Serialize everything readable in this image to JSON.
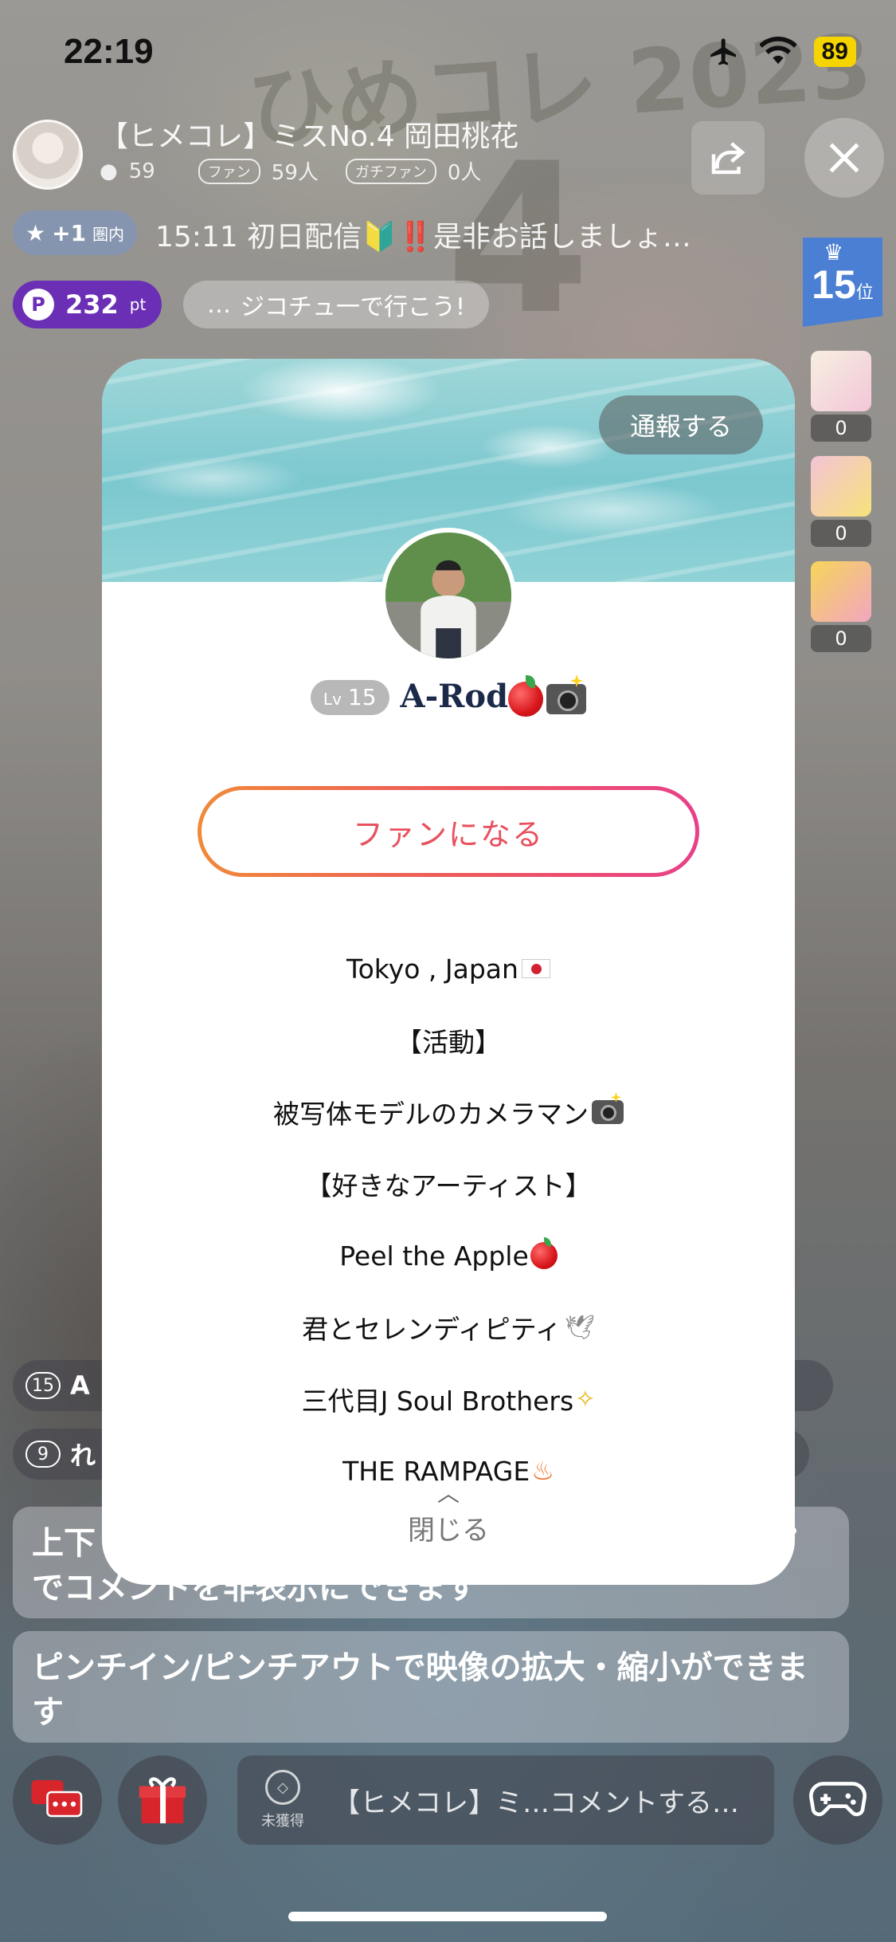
{
  "status_bar": {
    "time": "22:19",
    "battery": "89"
  },
  "stream": {
    "title": "【ヒメコレ】ミスNo.4 岡田桃花",
    "comment_count": "59",
    "fan_label": "ファン",
    "fan_count": "59人",
    "gachi_label": "ガチファン",
    "gachi_count": "0人",
    "rank": {
      "number": "15",
      "unit": "位"
    },
    "fan_tag": {
      "text": "+1",
      "sub": "圏内"
    },
    "ticker": "15:11  初日配信🔰‼️是非お話しましょ…",
    "points": {
      "value": "232",
      "unit": "pt"
    },
    "catchphrase": "ジコチュ一で行こう!",
    "gifts": [
      {
        "count": "0"
      },
      {
        "count": "0"
      },
      {
        "count": "0"
      }
    ]
  },
  "chat": {
    "rows": [
      {
        "level": "15",
        "text": "A"
      },
      {
        "level": "9",
        "text": "れ"
      }
    ],
    "system_messages": [
      "上下　　　　　　　　　　　　　　　　　　　　　プ\nでコメントを非表示にできます",
      "ピンチイン/ピンチアウトで映像の拡大・縮小ができます"
    ]
  },
  "bottom_bar": {
    "unearned_label": "未獲得",
    "comment_placeholder": "【ヒメコレ】ミ…コメントする…"
  },
  "profile": {
    "report_label": "通報する",
    "level_prefix": "Lv",
    "level": "15",
    "name": "A-Rod",
    "fan_button_label": "ファンになる",
    "bio": [
      "Tokyo , Japan",
      "【活動】",
      "被写体モデルのカメラマン",
      "【好きなアーティスト】",
      "Peel the Apple",
      "君とセレンディピティ",
      "三代目J Soul Brothers",
      "THE RAMPAGE"
    ],
    "close_label": "閉じる"
  },
  "colors": {
    "fan_gradient_start": "#f08a3a",
    "fan_gradient_end": "#e8408a",
    "fan_text": "#e8505e",
    "rank_blue": "#4a7fd4",
    "points_purple": "#6a2fb5"
  }
}
